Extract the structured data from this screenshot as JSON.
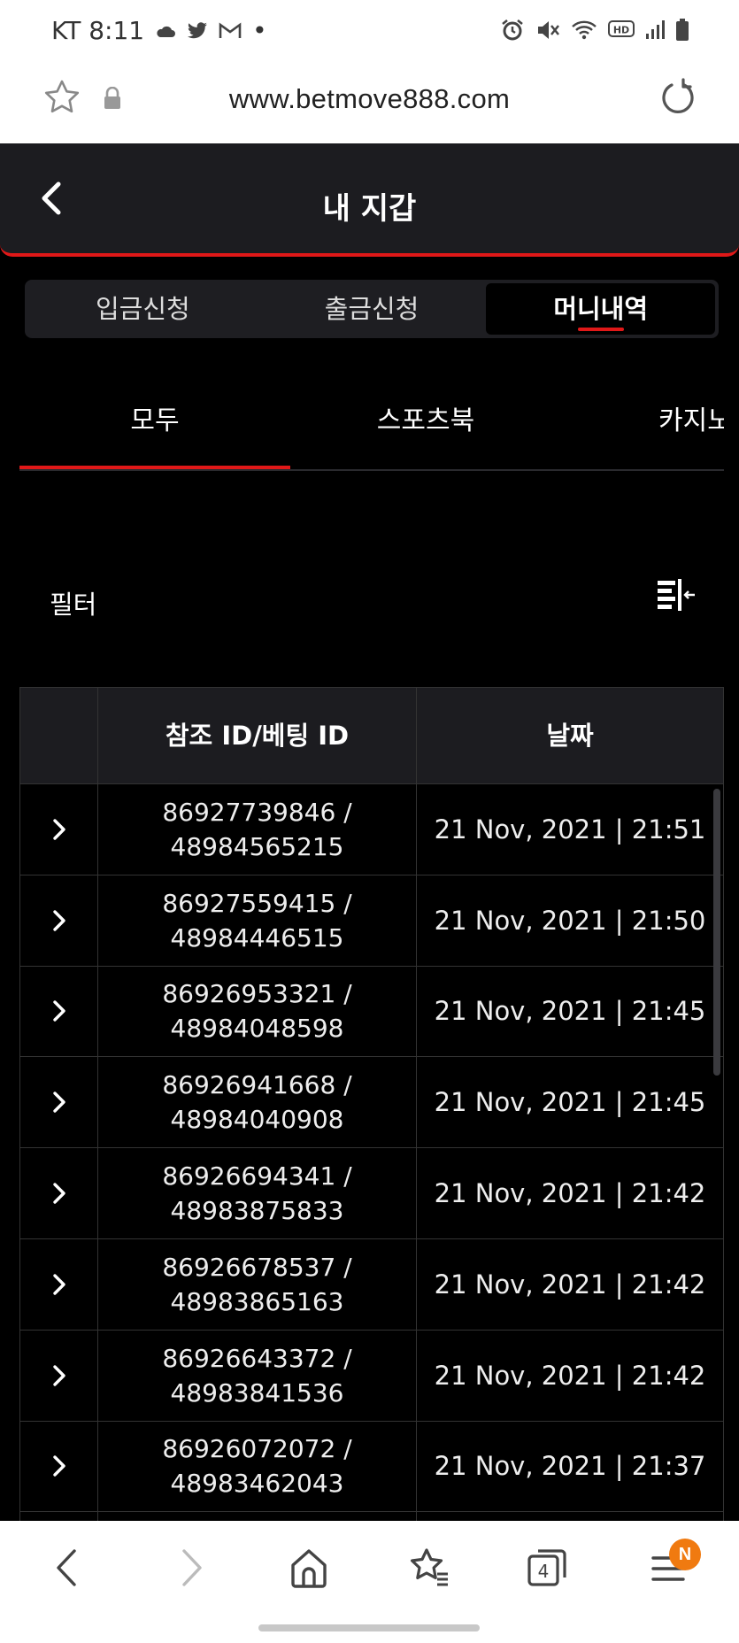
{
  "status_bar": {
    "carrier_time": "KT 8:11",
    "dot": "•",
    "hd_label": "HD"
  },
  "browser": {
    "url": "www.betmove888.com"
  },
  "header": {
    "title": "내 지갑"
  },
  "wallet_tabs": [
    {
      "label": "입금신청",
      "active": false
    },
    {
      "label": "출금신청",
      "active": false
    },
    {
      "label": "머니내역",
      "active": true
    }
  ],
  "category_tabs": [
    {
      "label": "모두",
      "active": true
    },
    {
      "label": "스포츠북",
      "active": false
    },
    {
      "label": "카지노",
      "active": false
    }
  ],
  "filter": {
    "label": "필터"
  },
  "table": {
    "headers": [
      "",
      "참조 ID/베팅 ID",
      "날짜"
    ],
    "rows": [
      {
        "ref_id": "86927739846 /",
        "bet_id": "48984565215",
        "date": "21 Nov, 2021 | 21:51"
      },
      {
        "ref_id": "86927559415 /",
        "bet_id": "48984446515",
        "date": "21 Nov, 2021 | 21:50"
      },
      {
        "ref_id": "86926953321 /",
        "bet_id": "48984048598",
        "date": "21 Nov, 2021 | 21:45"
      },
      {
        "ref_id": "86926941668 /",
        "bet_id": "48984040908",
        "date": "21 Nov, 2021 | 21:45"
      },
      {
        "ref_id": "86926694341 /",
        "bet_id": "48983875833",
        "date": "21 Nov, 2021 | 21:42"
      },
      {
        "ref_id": "86926678537 /",
        "bet_id": "48983865163",
        "date": "21 Nov, 2021 | 21:42"
      },
      {
        "ref_id": "86926643372 /",
        "bet_id": "48983841536",
        "date": "21 Nov, 2021 | 21:42"
      },
      {
        "ref_id": "86926072072 /",
        "bet_id": "48983462043",
        "date": "21 Nov, 2021 | 21:37"
      },
      {
        "ref_id": "",
        "bet_id": "",
        "date": ""
      }
    ]
  },
  "bottom_nav": {
    "tabs_count": "4",
    "menu_badge": "N"
  },
  "colors": {
    "accent": "#e01818",
    "header_bg": "#1c1c20",
    "badge": "#f07a10"
  }
}
